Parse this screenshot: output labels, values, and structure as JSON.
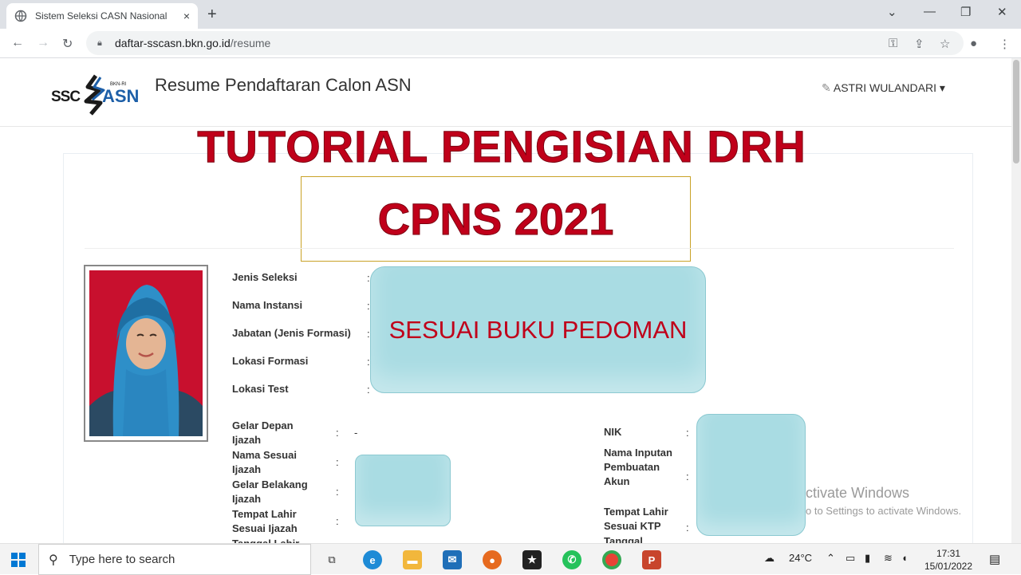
{
  "browser": {
    "tab_title": "Sistem Seleksi CASN Nasional",
    "tab_close": "×",
    "new_tab": "+",
    "url_host": "daftar-sscasn.bkn.go.id",
    "url_path": "/resume"
  },
  "site": {
    "logo_ssc": "SSC",
    "logo_asn": "ASN",
    "logo_bkn": "BKN-RI",
    "title": "Resume Pendaftaran Calon ASN",
    "user_name": "ASTRI WULANDARI",
    "user_caret": "▾"
  },
  "overlay": {
    "tutorial_title": "TUTORIAL PENGISIAN DRH",
    "cpns_title": "CPNS 2021",
    "pedoman_text": "SESUAI BUKU PEDOMAN"
  },
  "fields_top": [
    {
      "label": "Jenis Seleksi"
    },
    {
      "label": "Nama Instansi"
    },
    {
      "label": "Jabatan (Jenis Formasi)"
    },
    {
      "label": "Lokasi Formasi"
    },
    {
      "label": "Lokasi Test"
    }
  ],
  "fields_left": [
    {
      "label": "Gelar Depan Ijazah",
      "value": "-"
    },
    {
      "label": "Nama Sesuai Ijazah",
      "value": ""
    },
    {
      "label": "Gelar Belakang Ijazah",
      "value": ""
    },
    {
      "label": "Tempat Lahir Sesuai Ijazah",
      "value": ""
    },
    {
      "label": "Tanggal Lahir",
      "value": ""
    }
  ],
  "fields_right": [
    {
      "label": "NIK"
    },
    {
      "label": "Nama Inputan Pembuatan Akun"
    },
    {
      "label": "Tempat Lahir Sesuai KTP"
    },
    {
      "label": "Tanggal"
    }
  ],
  "watermark": {
    "line1": "ctivate Windows",
    "line2": "o to Settings to activate Windows."
  },
  "taskbar": {
    "search_placeholder": "Type here to search",
    "temperature": "24°C",
    "time": "17:31",
    "date": "15/01/2022"
  }
}
